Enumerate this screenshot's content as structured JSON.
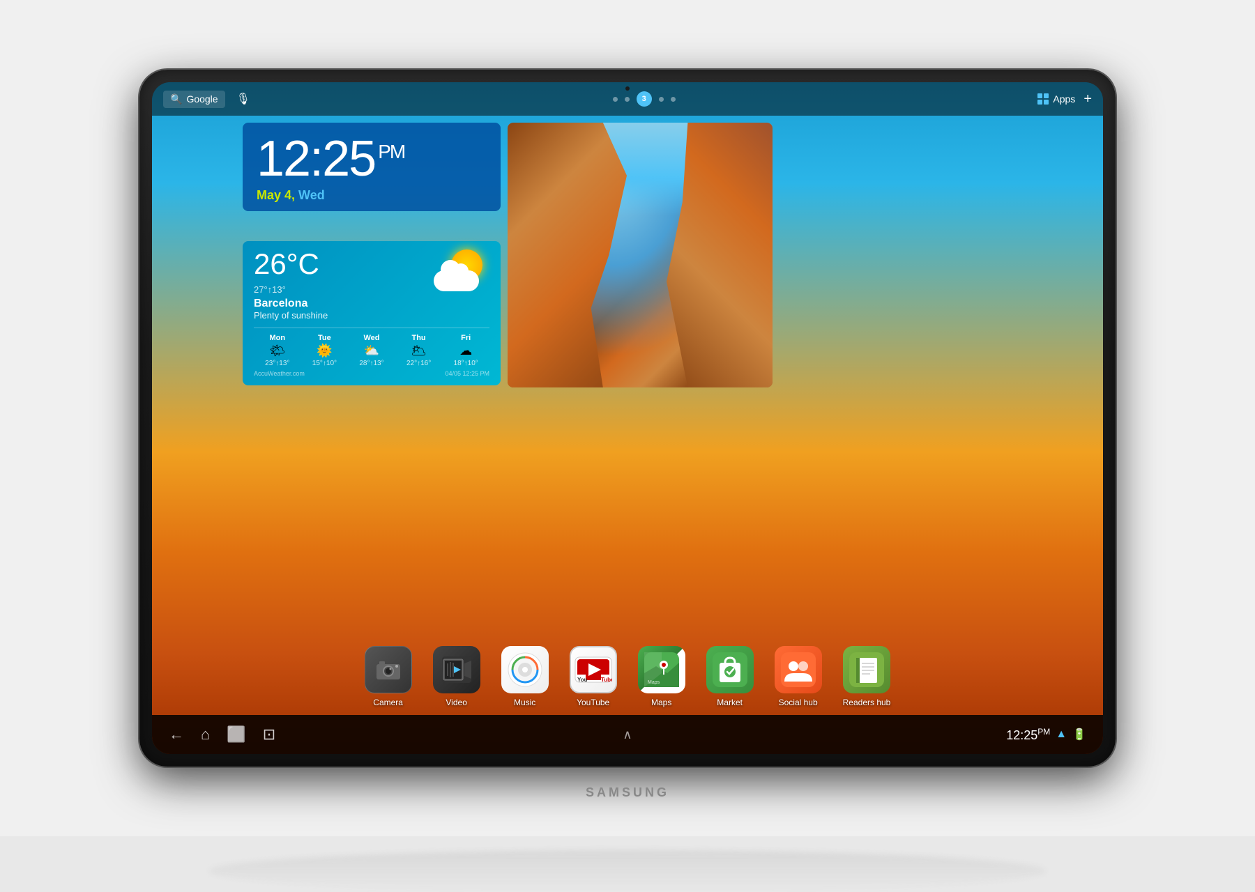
{
  "device": {
    "brand": "SAMSUNG"
  },
  "topbar": {
    "search_label": "Google",
    "apps_label": "Apps",
    "plus_label": "+",
    "dots": [
      {
        "id": 1,
        "active": false
      },
      {
        "id": 2,
        "active": false
      },
      {
        "id": 3,
        "active": true,
        "number": "3"
      },
      {
        "id": 4,
        "active": false
      },
      {
        "id": 5,
        "active": false
      }
    ]
  },
  "clock_widget": {
    "time": "12:25",
    "period": "PM",
    "date_month_day": "May 4,",
    "date_weekday": "Wed"
  },
  "weather_widget": {
    "temperature": "26°C",
    "hi_lo": "27°↑13°",
    "city": "Barcelona",
    "description": "Plenty of sunshine",
    "forecast": [
      {
        "day": "Mon",
        "temps": "23°↑13°",
        "icon": "🌤"
      },
      {
        "day": "Tue",
        "temps": "15°↑10°",
        "icon": "🌞"
      },
      {
        "day": "Wed",
        "temps": "28°↑13°",
        "icon": "⛅"
      },
      {
        "day": "Thu",
        "temps": "22°↑16°",
        "icon": "🌥"
      },
      {
        "day": "Fri",
        "temps": "18°↑10°",
        "icon": "☁"
      }
    ],
    "source": "AccuWeather.com",
    "timestamp": "04/05 12:25 PM"
  },
  "dock_apps": [
    {
      "id": "camera",
      "label": "Camera",
      "icon": "📷"
    },
    {
      "id": "video",
      "label": "Video",
      "icon": "🎬"
    },
    {
      "id": "music",
      "label": "Music",
      "icon": "🎵"
    },
    {
      "id": "youtube",
      "label": "YouTube",
      "icon": "▶"
    },
    {
      "id": "maps",
      "label": "Maps",
      "icon": "🗺"
    },
    {
      "id": "market",
      "label": "Market",
      "icon": "🛍"
    },
    {
      "id": "social-hub",
      "label": "Social hub",
      "icon": "👥"
    },
    {
      "id": "readers-hub",
      "label": "Readers hub",
      "icon": "📗"
    }
  ],
  "navbar": {
    "time": "12:25",
    "period": "PM"
  }
}
